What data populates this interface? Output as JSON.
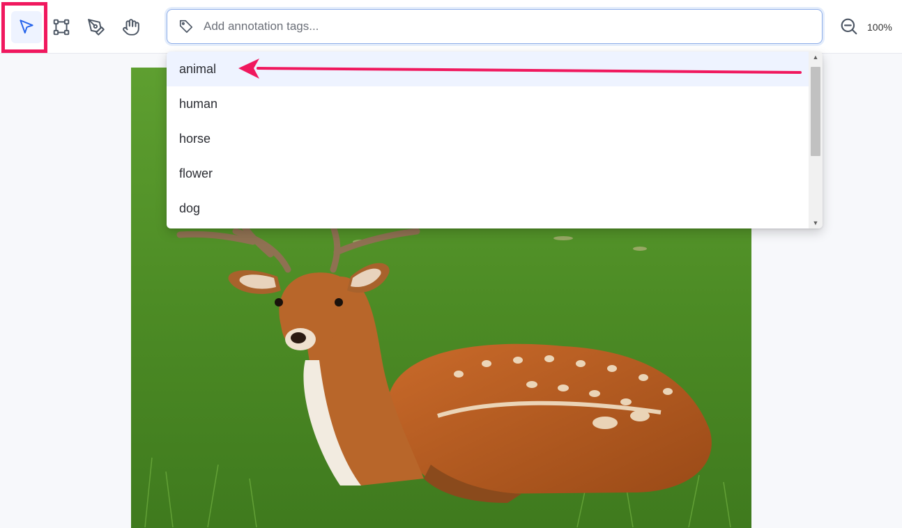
{
  "toolbar": {
    "tools": [
      {
        "icon": "pointer-icon",
        "active": true
      },
      {
        "icon": "bounding-box-icon",
        "active": false
      },
      {
        "icon": "pen-icon",
        "active": false
      },
      {
        "icon": "hand-icon",
        "active": false
      }
    ],
    "tag_input": {
      "placeholder": "Add annotation tags...",
      "value": ""
    },
    "zoom_level": "100%"
  },
  "dropdown": {
    "items": [
      "animal",
      "human",
      "horse",
      "flower",
      "dog"
    ],
    "selected": "animal"
  },
  "colors": {
    "accent": "#2563eb",
    "highlight": "#f0185e",
    "selected_bg": "#eef3ff"
  }
}
